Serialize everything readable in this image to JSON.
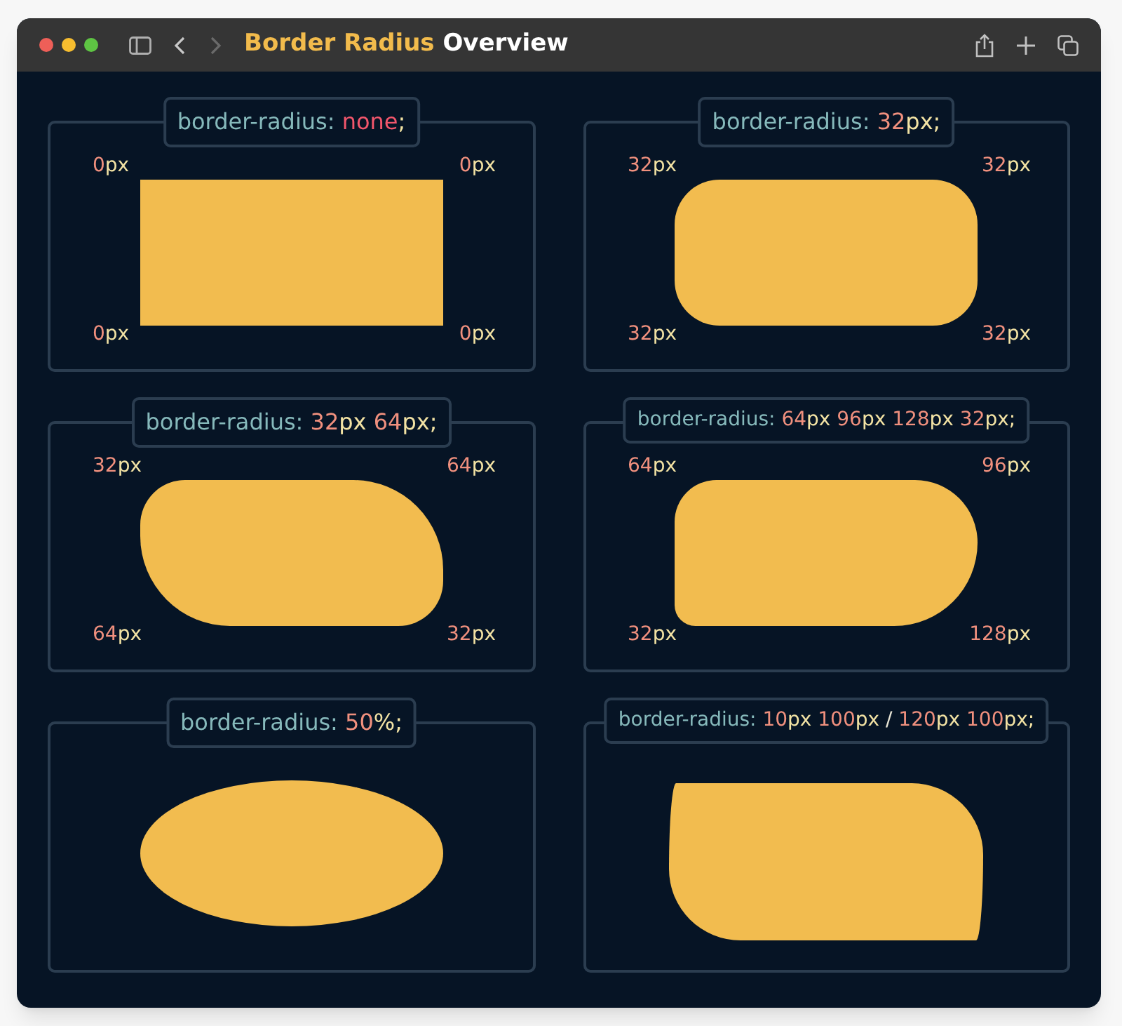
{
  "window": {
    "title": [
      {
        "kind": "accent",
        "text": "Border Radius"
      },
      {
        "kind": "plain",
        "text": " Overview"
      }
    ]
  },
  "panels": [
    {
      "code": [
        {
          "kind": "prop",
          "text": "border-radius:"
        },
        {
          "kind": "keyword",
          "text": " none"
        },
        {
          "kind": "punct",
          "text": ";"
        }
      ],
      "corners": [
        {
          "number": "0",
          "unit": "px"
        },
        {
          "number": "0",
          "unit": "px"
        },
        {
          "number": "0",
          "unit": "px"
        },
        {
          "number": "0",
          "unit": "px"
        }
      ]
    },
    {
      "code": [
        {
          "kind": "prop",
          "text": "border-radius:"
        },
        {
          "kind": "num",
          "text": " 32"
        },
        {
          "kind": "unit",
          "text": "px"
        },
        {
          "kind": "punct",
          "text": ";"
        }
      ],
      "corners": [
        {
          "number": "32",
          "unit": "px"
        },
        {
          "number": "32",
          "unit": "px"
        },
        {
          "number": "32",
          "unit": "px"
        },
        {
          "number": "32",
          "unit": "px"
        }
      ]
    },
    {
      "code": [
        {
          "kind": "prop",
          "text": "border-radius:"
        },
        {
          "kind": "num",
          "text": " 32"
        },
        {
          "kind": "unit",
          "text": "px"
        },
        {
          "kind": "num",
          "text": " 64"
        },
        {
          "kind": "unit",
          "text": "px"
        },
        {
          "kind": "punct",
          "text": ";"
        }
      ],
      "corners": [
        {
          "number": "32",
          "unit": "px"
        },
        {
          "number": "64",
          "unit": "px"
        },
        {
          "number": "64",
          "unit": "px"
        },
        {
          "number": "32",
          "unit": "px"
        }
      ]
    },
    {
      "code": [
        {
          "kind": "prop",
          "text": "border-radius:"
        },
        {
          "kind": "num",
          "text": " 64"
        },
        {
          "kind": "unit",
          "text": "px"
        },
        {
          "kind": "num",
          "text": " 96"
        },
        {
          "kind": "unit",
          "text": "px"
        },
        {
          "kind": "num",
          "text": " 128"
        },
        {
          "kind": "unit",
          "text": "px"
        },
        {
          "kind": "num",
          "text": " 32"
        },
        {
          "kind": "unit",
          "text": "px"
        },
        {
          "kind": "punct",
          "text": ";"
        }
      ],
      "corners": [
        {
          "number": "64",
          "unit": "px"
        },
        {
          "number": "96",
          "unit": "px"
        },
        {
          "number": "32",
          "unit": "px"
        },
        {
          "number": "128",
          "unit": "px"
        }
      ]
    },
    {
      "code": [
        {
          "kind": "prop",
          "text": "border-radius:"
        },
        {
          "kind": "num",
          "text": " 50"
        },
        {
          "kind": "unit",
          "text": "%"
        },
        {
          "kind": "punct",
          "text": ";"
        }
      ]
    },
    {
      "code": [
        {
          "kind": "prop",
          "text": "border-radius:"
        },
        {
          "kind": "num",
          "text": " 10"
        },
        {
          "kind": "unit",
          "text": "px"
        },
        {
          "kind": "num",
          "text": " 100"
        },
        {
          "kind": "unit",
          "text": "px"
        },
        {
          "kind": "slash",
          "text": " /"
        },
        {
          "kind": "num",
          "text": " 120"
        },
        {
          "kind": "unit",
          "text": "px"
        },
        {
          "kind": "num",
          "text": " 100"
        },
        {
          "kind": "unit",
          "text": "px"
        },
        {
          "kind": "punct",
          "text": ";"
        }
      ]
    }
  ]
}
